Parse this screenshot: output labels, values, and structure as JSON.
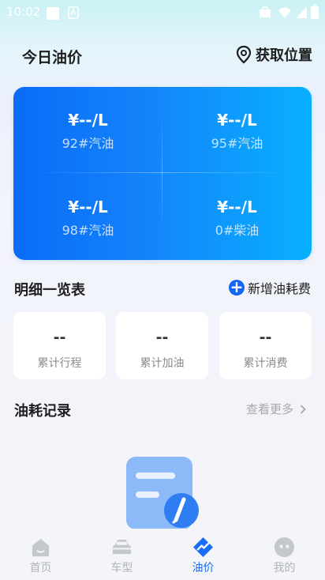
{
  "status_bar": {
    "time": "10:02"
  },
  "header": {
    "title": "今日油价",
    "location_label": "获取位置"
  },
  "prices": [
    {
      "value": "¥--/L",
      "type": "92#汽油"
    },
    {
      "value": "¥--/L",
      "type": "95#汽油"
    },
    {
      "value": "¥--/L",
      "type": "98#汽油"
    },
    {
      "value": "¥--/L",
      "type": "0#柴油"
    }
  ],
  "details": {
    "title": "明细一览表",
    "add_label": "新增油耗费",
    "stats": [
      {
        "value": "--",
        "label": "累计行程"
      },
      {
        "value": "--",
        "label": "累计加油"
      },
      {
        "value": "--",
        "label": "累计消费"
      }
    ]
  },
  "records": {
    "title": "油耗记录",
    "more_label": "查看更多"
  },
  "tabs": [
    {
      "label": "首页"
    },
    {
      "label": "车型"
    },
    {
      "label": "油价"
    },
    {
      "label": "我的"
    }
  ],
  "colors": {
    "accent": "#1b6cf7",
    "inactive": "#b0b3b8"
  }
}
